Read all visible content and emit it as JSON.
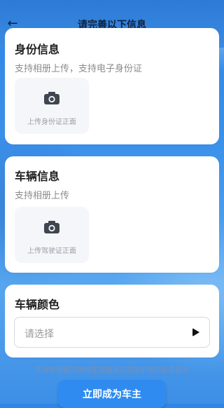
{
  "header": {
    "title": "请完善以下信息",
    "back_icon": "arrow-left-icon"
  },
  "id_section": {
    "title": "身份信息",
    "subtitle": "支持相册上传，支持电子身份证",
    "upload_label": "上传身份证正面",
    "icon": "camera-icon"
  },
  "vehicle_section": {
    "title": "车辆信息",
    "subtitle": "支持相册上传",
    "upload_label": "上传驾驶证正面",
    "icon": "camera-icon"
  },
  "color_section": {
    "title": "车辆颜色",
    "select_placeholder": "请选择",
    "dropdown_icon": "play-triangle-icon"
  },
  "privacy_note": "平台将根据法律规定及相关约定保护你的信息安全",
  "cta_label": "立即成为车主"
}
